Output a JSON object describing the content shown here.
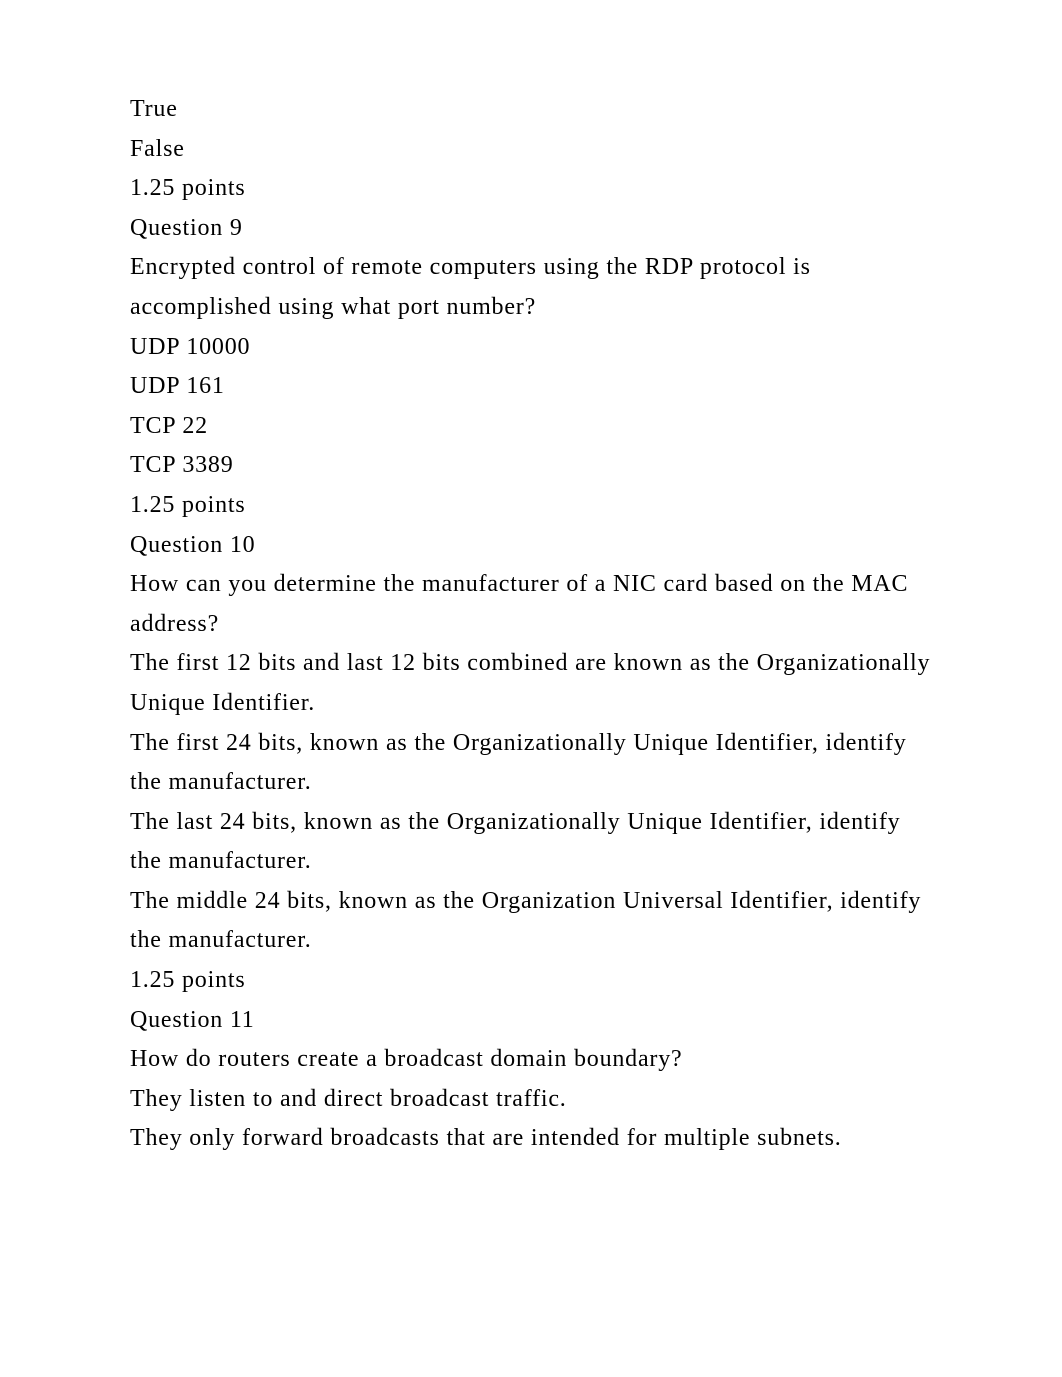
{
  "lines": {
    "l0": "True",
    "l1": "False",
    "l2": "1.25 points",
    "l3": "Question 9",
    "l4": "Encrypted control of remote computers using the RDP protocol is accomplished using what port number?",
    "l5": "UDP 10000",
    "l6": "UDP 161",
    "l7": "TCP 22",
    "l8": "TCP 3389",
    "l9": "1.25 points",
    "l10": "Question 10",
    "l11": "How can you determine the manufacturer of a NIC card based on the MAC address?",
    "l12": "The first 12 bits and last 12 bits combined are known as the Organizationally Unique Identifier.",
    "l13": "The first 24 bits, known as the Organizationally Unique Identifier, identify the manufacturer.",
    "l14": "The last 24 bits, known as the Organizationally Unique Identifier, identify the manufacturer.",
    "l15": "The middle 24 bits, known as the Organization Universal Identifier, identify the manufacturer.",
    "l16": "1.25 points",
    "l17": "Question 11",
    "l18": "How do routers create a broadcast domain boundary?",
    "l19": "They listen to and direct broadcast traffic.",
    "l20": "They only forward broadcasts that are intended for multiple subnets."
  }
}
